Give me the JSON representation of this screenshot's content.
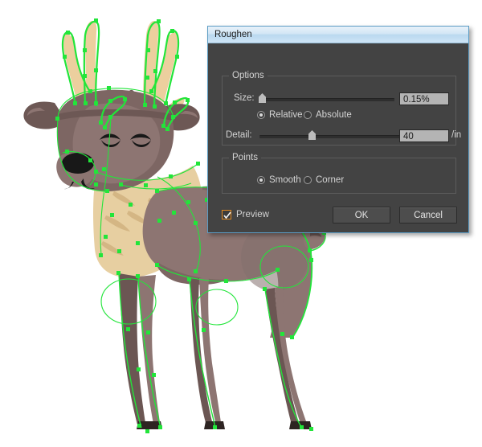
{
  "app": {
    "canvas_background": "#ffffff",
    "selection_color": "#22e53a"
  },
  "artwork": {
    "name": "deer-illustration",
    "description": "Vector illustration of a standing deer with antlers, selected showing green anchor points and paths",
    "colors": {
      "antler": "#eccf9e",
      "antler_shadow": "#d9b683",
      "body": "#8d7572",
      "body_dark": "#6b5653",
      "head": "#7d6663",
      "head_light": "#8e7774",
      "chest_fur": "#e7cfa1",
      "chest_fur_shadow": "#d4b684",
      "nose": "#181818",
      "eye": "#181818",
      "leg_dark": "#5c4a47",
      "selection": "#22e53a"
    }
  },
  "dialog": {
    "name": "roughen-dialog",
    "title": "Roughen",
    "titlebar_color": "#cfe5f6",
    "body_color": "#434343",
    "border_color": "#5b9cc4",
    "options": {
      "legend": "Options",
      "size": {
        "label": "Size:",
        "value": "0.15%",
        "slider_percent": 2
      },
      "size_mode": {
        "selected": "Relative",
        "choices": [
          {
            "label": "Relative",
            "checked": true
          },
          {
            "label": "Absolute",
            "checked": false
          }
        ]
      },
      "detail": {
        "label": "Detail:",
        "value": "40",
        "unit": "/in",
        "slider_percent": 38
      }
    },
    "points": {
      "legend": "Points",
      "selected": "Smooth",
      "choices": [
        {
          "label": "Smooth",
          "checked": true
        },
        {
          "label": "Corner",
          "checked": false
        }
      ]
    },
    "preview": {
      "label": "Preview",
      "checked": true,
      "accent": "#e08a23"
    },
    "buttons": {
      "ok": "OK",
      "cancel": "Cancel"
    }
  }
}
